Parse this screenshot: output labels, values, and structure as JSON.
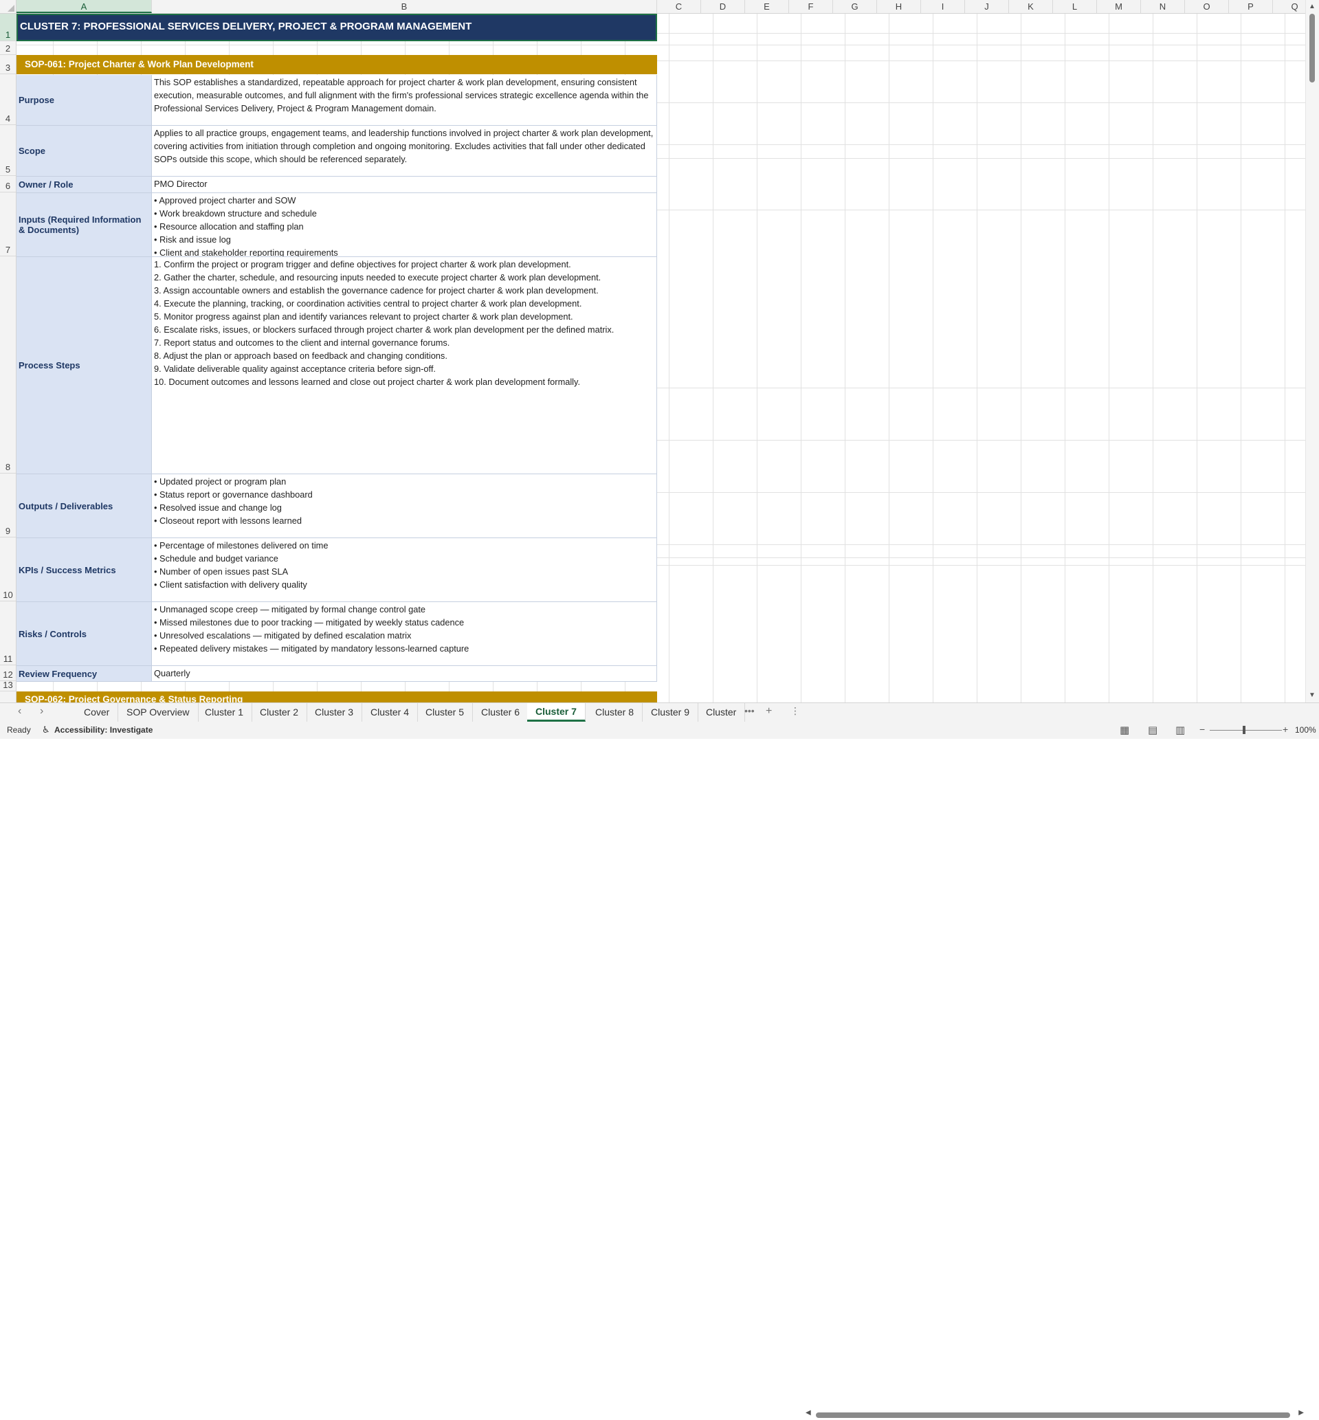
{
  "columns": [
    "A",
    "B",
    "C",
    "D",
    "E",
    "F",
    "G",
    "H",
    "I",
    "J",
    "K",
    "L",
    "M",
    "N",
    "O",
    "P",
    "Q"
  ],
  "selected_cell": {
    "col": "A",
    "row": 1
  },
  "rows": [
    "1",
    "2",
    "3",
    "4",
    "5",
    "6",
    "7",
    "8",
    "9",
    "10",
    "11",
    "12",
    "13"
  ],
  "title": "CLUSTER 7: PROFESSIONAL SERVICES DELIVERY, PROJECT & PROGRAM MANAGEMENT",
  "sop_header": "SOP-061:  Project Charter & Work Plan Development",
  "sop_header_next": "SOP-062:  Project Governance & Status Reporting",
  "fields": [
    {
      "label": "Purpose",
      "value": "This SOP establishes a standardized, repeatable approach for project charter & work plan development, ensuring consistent execution, measurable outcomes, and full alignment with the firm's professional services strategic excellence agenda within the Professional Services Delivery, Project & Program Management domain."
    },
    {
      "label": "Scope",
      "value": "Applies to all practice groups, engagement teams, and leadership functions involved in project charter & work plan development, covering activities from initiation through completion and ongoing monitoring. Excludes activities that fall under other dedicated SOPs outside this scope, which should be referenced separately."
    },
    {
      "label": "Owner / Role",
      "value": "PMO Director"
    },
    {
      "label": "Inputs (Required Information & Documents)",
      "value": "• Approved project charter and SOW\n• Work breakdown structure and schedule\n• Resource allocation and staffing plan\n• Risk and issue log\n• Client and stakeholder reporting requirements"
    },
    {
      "label": "Process Steps",
      "value": "1. Confirm the project or program trigger and define objectives for project charter & work plan development.\n2. Gather the charter, schedule, and resourcing inputs needed to execute project charter & work plan development.\n3. Assign accountable owners and establish the governance cadence for project charter & work plan development.\n4. Execute the planning, tracking, or coordination activities central to project charter & work plan development.\n5. Monitor progress against plan and identify variances relevant to project charter & work plan development.\n6. Escalate risks, issues, or blockers surfaced through project charter & work plan development per the defined matrix.\n7. Report status and outcomes to the client and internal governance forums.\n8. Adjust the plan or approach based on feedback and changing conditions.\n9. Validate deliverable quality against acceptance criteria before sign-off.\n10. Document outcomes and lessons learned and close out project charter & work plan development formally."
    },
    {
      "label": "Outputs / Deliverables",
      "value": "• Updated project or program plan\n• Status report or governance dashboard\n• Resolved issue and change log\n• Closeout report with lessons learned"
    },
    {
      "label": "KPIs / Success Metrics",
      "value": "• Percentage of milestones delivered on time\n• Schedule and budget variance\n• Number of open issues past SLA\n• Client satisfaction with delivery quality"
    },
    {
      "label": "Risks / Controls",
      "value": "• Unmanaged scope creep — mitigated by formal change control gate\n• Missed milestones due to poor tracking — mitigated by weekly status cadence\n• Unresolved escalations — mitigated by defined escalation matrix\n• Repeated delivery mistakes — mitigated by mandatory lessons-learned capture"
    },
    {
      "label": "Review Frequency",
      "value": "Quarterly"
    }
  ],
  "tabs": [
    "Cover",
    "SOP Overview",
    "Cluster 1",
    "Cluster 2",
    "Cluster 3",
    "Cluster 4",
    "Cluster 5",
    "Cluster 6",
    "Cluster 7",
    "Cluster 8",
    "Cluster 9",
    "Cluster"
  ],
  "active_tab": "Cluster 7",
  "status": {
    "ready": "Ready",
    "accessibility": "Accessibility: Investigate",
    "zoom": "100%"
  }
}
